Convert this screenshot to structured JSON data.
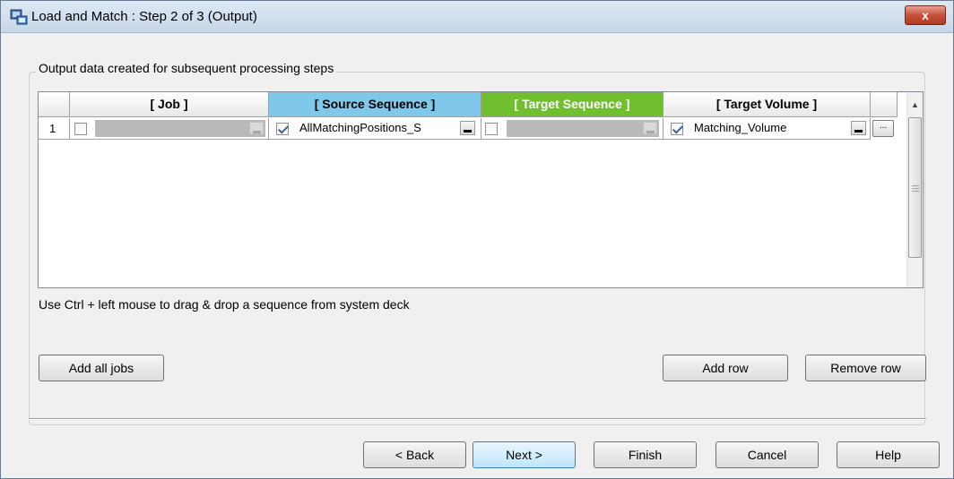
{
  "window": {
    "title": "Load and Match : Step 2 of 3 (Output)",
    "close_label": "x"
  },
  "group": {
    "legend": "Output data created for subsequent processing steps"
  },
  "grid": {
    "columns": [
      {
        "label": "[ Job ]",
        "color": "#ffffff"
      },
      {
        "label": "[ Source Sequence ]",
        "color": "#7fc8ea"
      },
      {
        "label": "[ Target Sequence ]",
        "color": "#70bf2f"
      },
      {
        "label": "[ Target Volume ]",
        "color": "#ffffff"
      }
    ],
    "rows": [
      {
        "number": "1",
        "job_checked": false,
        "job_value": "",
        "source_checked": true,
        "source_value": "AllMatchingPositions_S",
        "target_checked": false,
        "target_value": "",
        "volume_checked": true,
        "volume_value": "Matching_Volume",
        "browse_label": "..."
      }
    ]
  },
  "hint": "Use Ctrl + left mouse to drag & drop a sequence from system deck",
  "buttons": {
    "add_all_jobs": "Add all jobs",
    "add_row": "Add row",
    "remove_row": "Remove row",
    "back": "< Back",
    "next": "Next >",
    "finish": "Finish",
    "cancel": "Cancel",
    "help": "Help"
  }
}
